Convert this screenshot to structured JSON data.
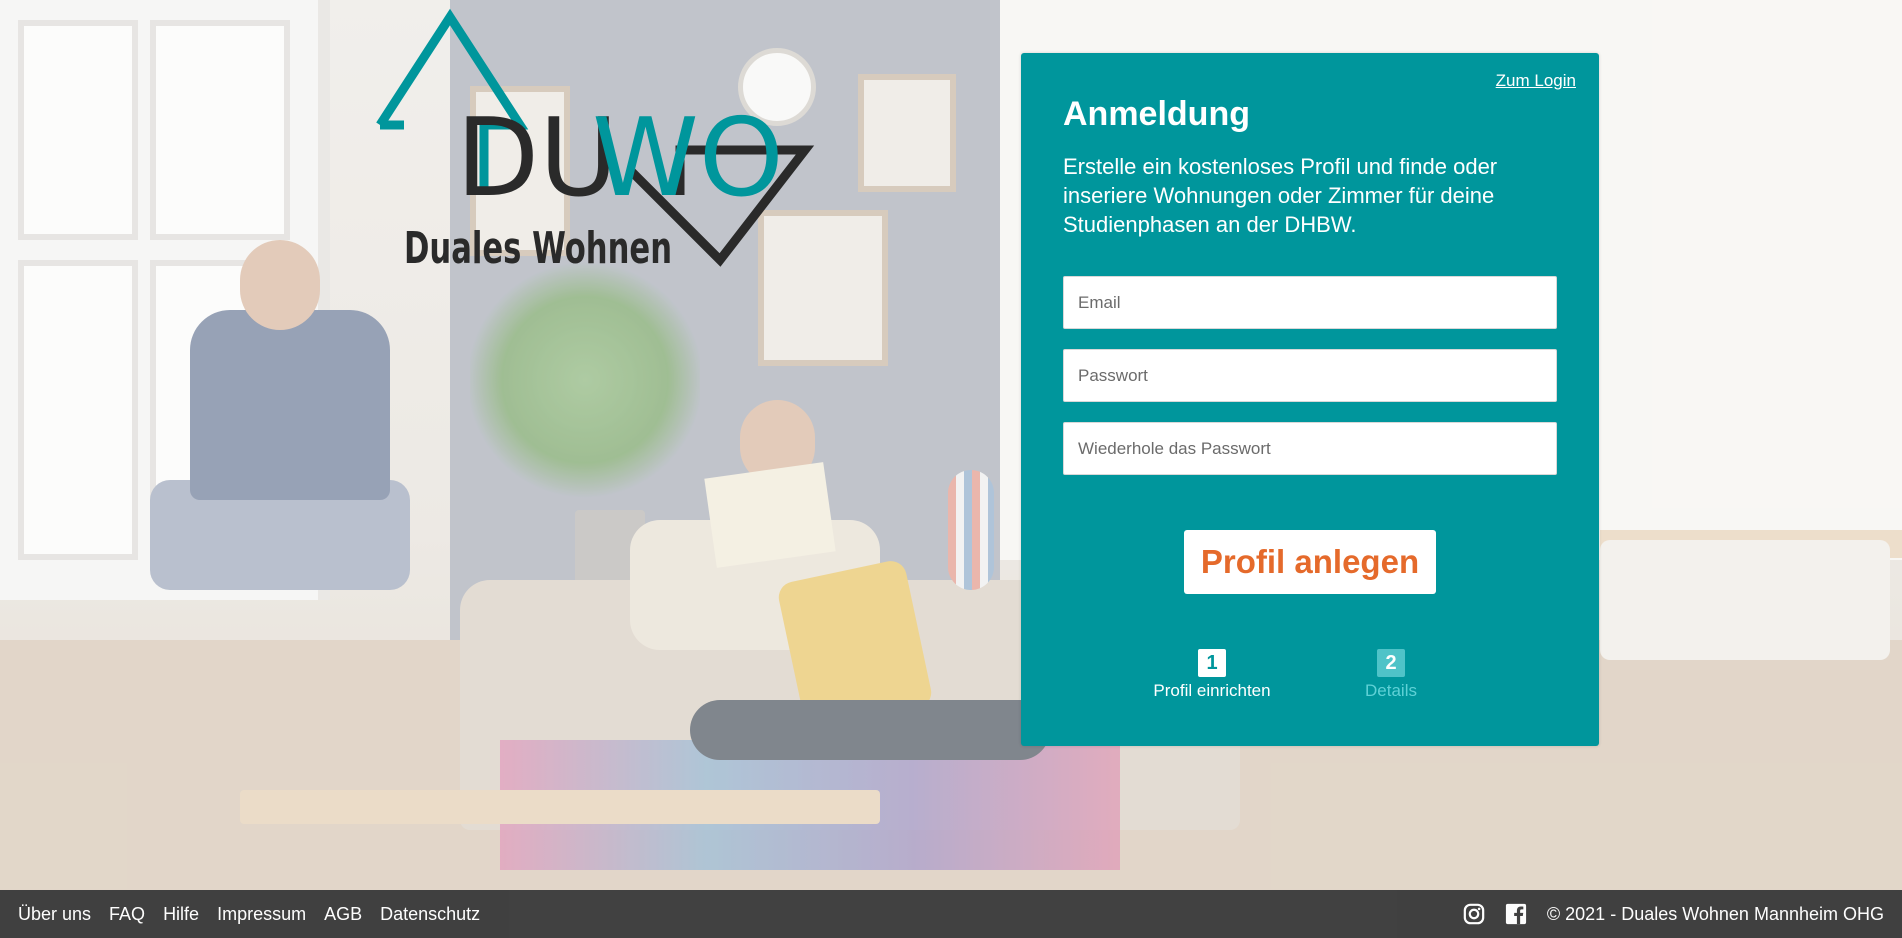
{
  "logo": {
    "wordmark_left": "DU",
    "wordmark_right": "WO",
    "tagline": "Duales Wohnen"
  },
  "signup": {
    "login_link": "Zum Login",
    "title": "Anmeldung",
    "intro": "Erstelle ein kostenloses Profil und finde oder inseriere Wohnungen oder Zimmer für deine Studienphasen an der DHBW.",
    "email_placeholder": "Email",
    "password_placeholder": "Passwort",
    "password_repeat_placeholder": "Wiederhole das Passwort",
    "submit_label": "Profil anlegen",
    "steps": [
      {
        "number": "1",
        "label": "Profil einrichten",
        "active": true
      },
      {
        "number": "2",
        "label": "Details",
        "active": false
      }
    ]
  },
  "footer": {
    "links": [
      "Über uns",
      "FAQ",
      "Hilfe",
      "Impressum",
      "AGB",
      "Datenschutz"
    ],
    "icons": [
      "instagram-icon",
      "facebook-icon"
    ],
    "copyright": "© 2021 - Duales Wohnen Mannheim OHG"
  },
  "colors": {
    "brand_teal": "#00969c",
    "accent_orange": "#e56a2b",
    "logo_dark": "#2a2a2a",
    "footer_bg": "#3c3c3c"
  }
}
